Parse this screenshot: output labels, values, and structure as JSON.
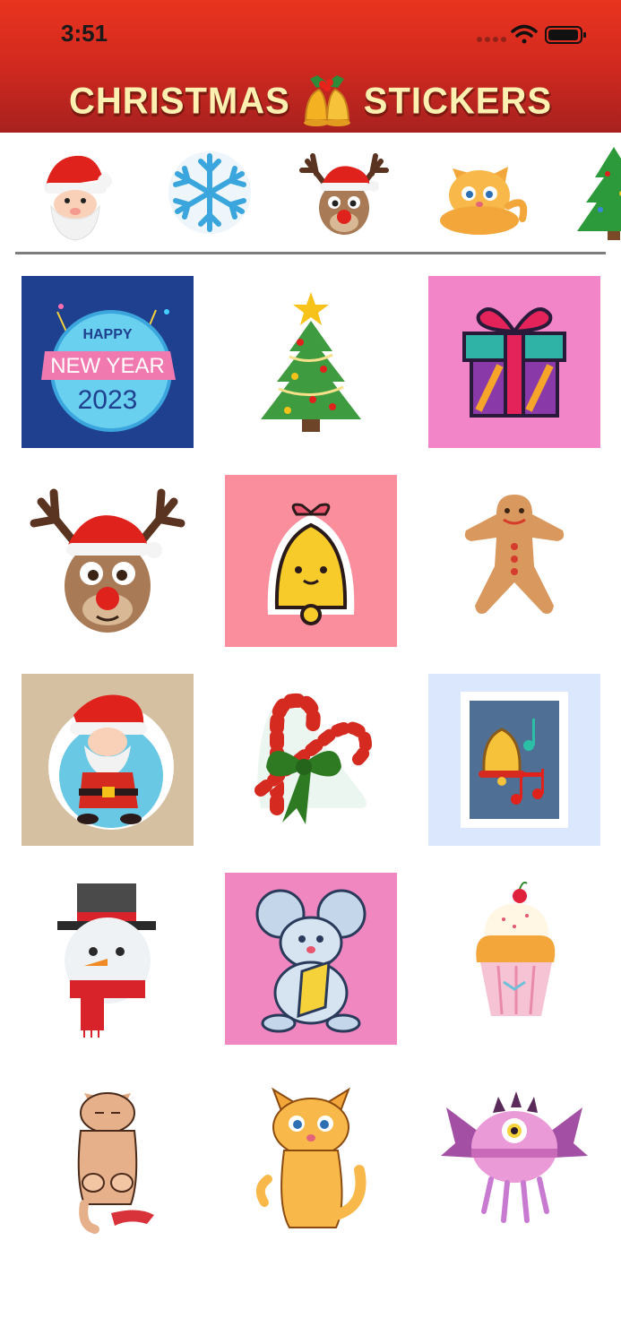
{
  "status_bar": {
    "time": "3:51"
  },
  "header": {
    "title_left": "CHRISTMAS",
    "title_right": "STICKERS",
    "logo_icon": "bells-icon"
  },
  "categories": [
    {
      "icon": "santa-face-icon"
    },
    {
      "icon": "snowflake-icon"
    },
    {
      "icon": "reindeer-icon"
    },
    {
      "icon": "cat-icon"
    },
    {
      "icon": "christmas-tree-icon"
    }
  ],
  "stickers": [
    {
      "icon": "happy-new-year-sticker",
      "background": "#1f3f8f",
      "lines": [
        "HAPPY",
        "NEW YEAR",
        "2023"
      ]
    },
    {
      "icon": "christmas-tree-sticker",
      "background": "#ffffff"
    },
    {
      "icon": "gift-box-sticker",
      "background": "#f185c7"
    },
    {
      "icon": "reindeer-sticker",
      "background": "#ffffff"
    },
    {
      "icon": "bell-sticker",
      "background": "#fa8e9c"
    },
    {
      "icon": "gingerbread-man-sticker",
      "background": "#ffffff"
    },
    {
      "icon": "dancing-santa-sticker",
      "background": "#d5c1a2"
    },
    {
      "icon": "candy-cane-sticker",
      "background": "#ffffff"
    },
    {
      "icon": "bell-stamp-sticker",
      "background": "#dbe7fc"
    },
    {
      "icon": "snowman-sticker",
      "background": "#ffffff"
    },
    {
      "icon": "mouse-cheese-sticker",
      "background": "#f087c0"
    },
    {
      "icon": "cupcake-sticker",
      "background": "#ffffff"
    },
    {
      "icon": "sleepy-cat-sticker",
      "background": "#ffffff"
    },
    {
      "icon": "sitting-cat-sticker",
      "background": "#ffffff"
    },
    {
      "icon": "monster-sticker",
      "background": "#ffffff"
    }
  ]
}
